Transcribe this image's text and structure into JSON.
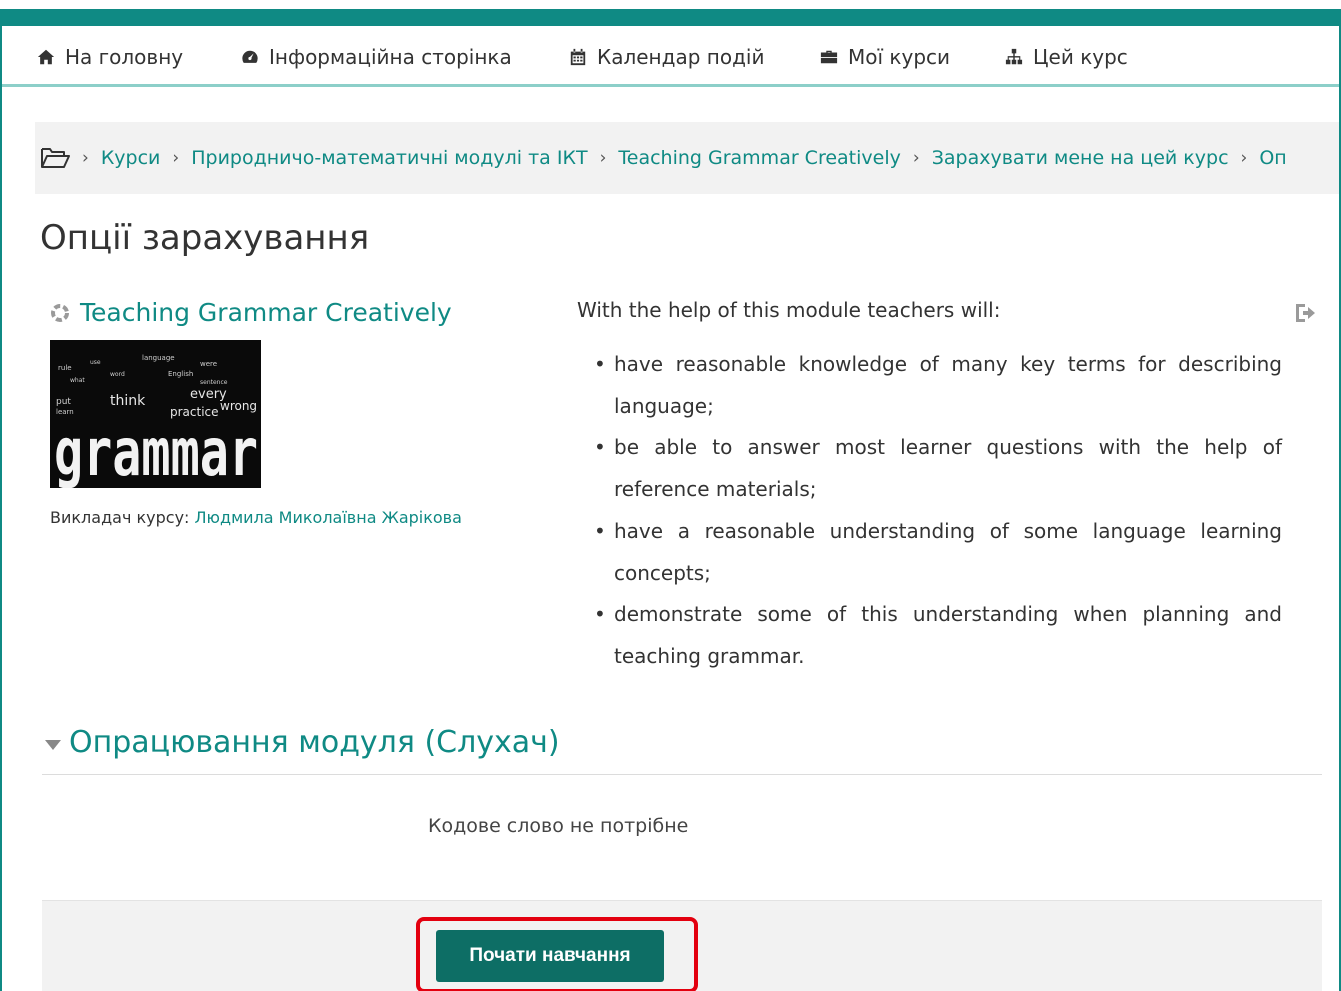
{
  "nav": {
    "items": [
      {
        "label": "На головну",
        "icon": "home-icon"
      },
      {
        "label": "Інформаційна сторінка",
        "icon": "dashboard-icon"
      },
      {
        "label": "Календар подій",
        "icon": "calendar-icon"
      },
      {
        "label": "Мої курси",
        "icon": "briefcase-icon"
      },
      {
        "label": "Цей курс",
        "icon": "sitemap-icon"
      }
    ]
  },
  "breadcrumb": {
    "items": [
      "Курси",
      "Природничо-математичні модулі та ІКТ",
      "Teaching Grammar Creatively",
      "Зарахувати мене на цей курс",
      "Оп"
    ]
  },
  "page": {
    "title": "Опції зарахування"
  },
  "course": {
    "title": "Teaching Grammar Creatively",
    "image_text": {
      "main": "grammar",
      "words": [
        "think",
        "every",
        "wrong",
        "practice",
        "English",
        "rule",
        "learn",
        "use",
        "word",
        "language",
        "put",
        "what",
        "sentence",
        "were"
      ]
    },
    "teacher_label": "Викладач курсу:",
    "teacher_name": "Людмила Миколаївна Жарікова",
    "summary_intro": "With the help of this module teachers will:",
    "summary_items": [
      "have reasonable knowledge of many key terms for describing language;",
      "be able to answer most learner questions with the help of reference materials;",
      "have a reasonable understanding of some language learning concepts;",
      "demonstrate some of this understanding when planning and teaching grammar."
    ]
  },
  "enrol": {
    "section_title": "Опрацювання модуля (Слухач)",
    "no_key_text": "Кодове слово не потрібне",
    "button_label": "Почати навчання"
  },
  "colors": {
    "accent": "#0f8a84",
    "button": "#0d6e65",
    "highlight": "#e3000f"
  }
}
